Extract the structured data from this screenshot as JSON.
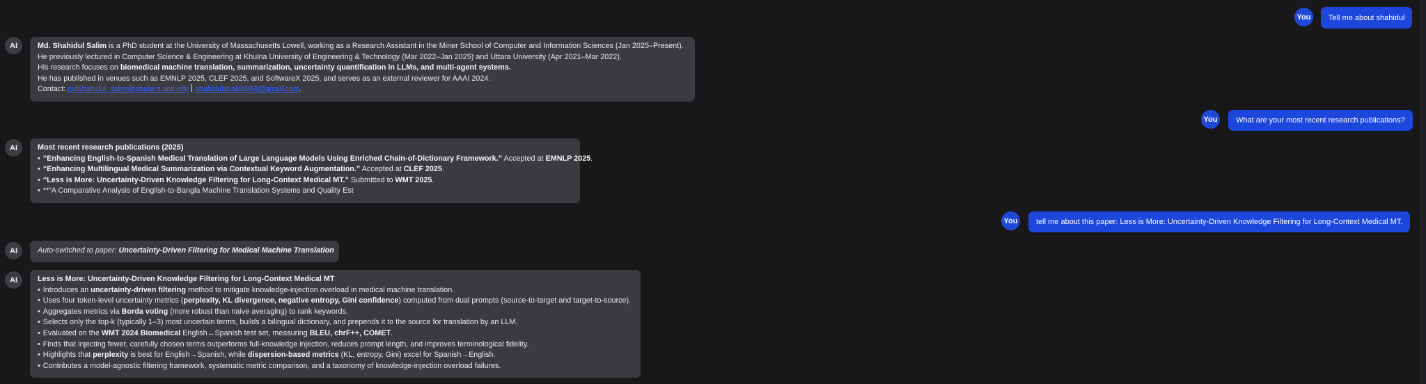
{
  "labels": {
    "you": "You",
    "ai": "AI"
  },
  "messages": {
    "q1": "Tell me about shahidul",
    "a1": {
      "line1": {
        "name": "Md. Shahidul Salim",
        "rest": " is a PhD student at the University of Massachusetts Lowell, working as a Research Assistant in the Miner School of Computer and Information Sciences (Jan 2025–Present)."
      },
      "line2": "He previously lectured in Computer Science & Engineering at Khulna University of Engineering & Technology (Mar 2022–Jan 2025) and Uttara University (Apr 2021–Mar 2022).",
      "line3": {
        "pre": "His research focuses on ",
        "bold": "biomedical machine translation, summarization, uncertainty quantification in LLMs, and multi-agent systems."
      },
      "line4": "He has published in venues such as EMNLP 2025, CLEF 2025, and SoftwareX 2025, and serves as an external reviewer for AAAI 2024.",
      "contact_label": "Contact: ",
      "email1": "mdshahidul_salim@student.uml.edu",
      "email2": "shahidulshakib034@gmail.com",
      "contact_end": "."
    },
    "q2": "What are your most recent research publications?",
    "a2": {
      "heading": "Most recent research publications (2025)",
      "items": [
        {
          "title": "“Enhancing English-to-Spanish Medical Translation of Large Language Models Using Enriched Chain-of-Dictionary Framework.”",
          "status": " Accepted at ",
          "venue": "EMNLP 2025",
          "end": "."
        },
        {
          "title": "“Enhancing Multilingual Medical Summarization via Contextual Keyword Augmentation.”",
          "status": " Accepted at ",
          "venue": "CLEF 2025",
          "end": "."
        },
        {
          "title": "“Less is More: Uncertainty-Driven Knowledge Filtering for Long-Context Medical MT.”",
          "status": " Submitted to ",
          "venue": "WMT 2025",
          "end": "."
        }
      ],
      "last_item": "**“A Comparative Analysis of English-to-Bangla Machine Translation Systems and Quality Est"
    },
    "q3": "tell me about this paper: Less is More: Uncertainty-Driven Knowledge Filtering for Long-Context Medical MT.",
    "a3_note": {
      "pre": "Auto-switched to paper: ",
      "bold": "Uncertainty-Driven Filtering for Medical Machine Translation"
    },
    "a4": {
      "heading": "Less is More: Uncertainty-Driven Knowledge Filtering for Long-Context Medical MT",
      "b1": {
        "pre": "Introduces an ",
        "bold": "uncertainty-driven filtering",
        "post": " method to mitigate knowledge-injection overload in medical machine translation."
      },
      "b2": {
        "pre": "Uses four token-level uncertainty metrics (",
        "bold": "perplexity, KL divergence, negative entropy, Gini confidence",
        "post": ") computed from dual prompts (source-to-target and target-to-source)."
      },
      "b3": {
        "pre": "Aggregates metrics via ",
        "bold": "Borda voting",
        "post": " (more robust than naive averaging) to rank keywords."
      },
      "b4": "Selects only the top-k (typically 1–3) most uncertain terms, builds a bilingual dictionary, and prepends it to the source for translation by an LLM.",
      "b5": {
        "pre": "Evaluated on the ",
        "bold": "WMT 2024 Biomedical",
        "mid": " English↔Spanish test set, measuring ",
        "bold2": "BLEU, chrF++, COMET",
        "post": "."
      },
      "b6": "Finds that injecting fewer, carefully chosen terms outperforms full-knowledge injection, reduces prompt length, and improves terminological fidelity.",
      "b7": {
        "pre": "Highlights that ",
        "bold": "perplexity",
        "mid": " is best for English→Spanish, while ",
        "bold2": "dispersion-based metrics",
        "post": " (KL, entropy, Gini) excel for Spanish→English."
      },
      "b8": "Contributes a model-agnostic filtering framework, systematic metric comparison, and a taxonomy of knowledge-injection overload failures."
    }
  }
}
